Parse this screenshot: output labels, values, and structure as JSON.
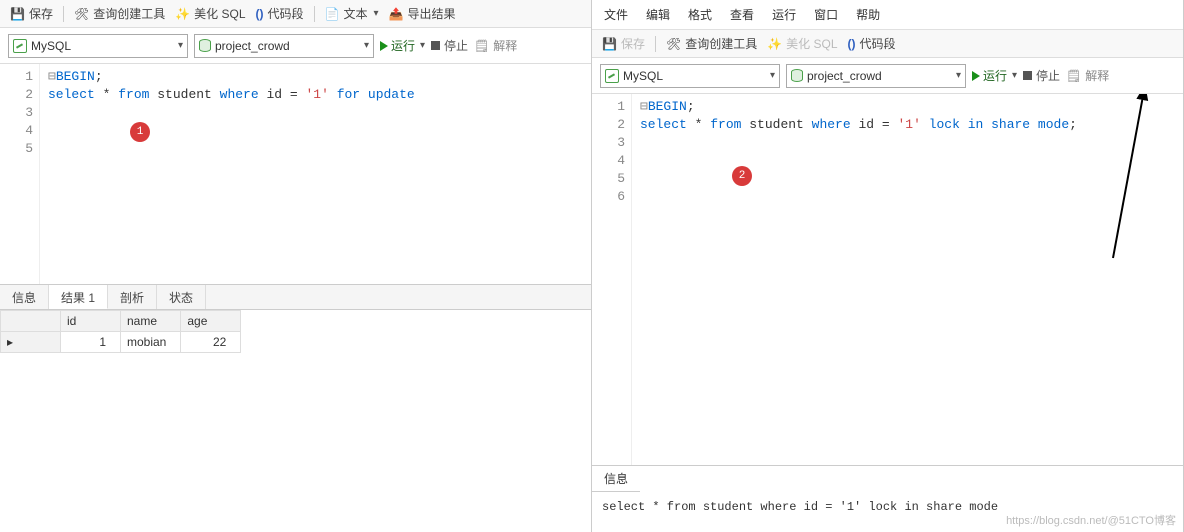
{
  "left": {
    "toolbarA": {
      "save": "保存",
      "queryBuilder": "查询创建工具",
      "beautify": "美化 SQL",
      "snippet": "代码段",
      "text": "文本",
      "export": "导出结果"
    },
    "toolbarB": {
      "connection": "MySQL",
      "database": "project_crowd",
      "run": "运行",
      "stop": "停止",
      "explain": "解释"
    },
    "code": {
      "lines": [
        "1",
        "2",
        "3",
        "4",
        "5"
      ],
      "l1_begin": "BEGIN",
      "l1_semi": ";",
      "l2_select": "select",
      "l2_star": " * ",
      "l2_from": "from",
      "l2_student": " student ",
      "l2_where": "where",
      "l2_id_eq": " id = ",
      "l2_val": "'1'",
      "l2_for": " for ",
      "l2_update": "update"
    },
    "badge": "1",
    "tabs": {
      "info": "信息",
      "result1": "结果 1",
      "profile": "剖析",
      "status": "状态"
    },
    "table": {
      "headers": {
        "id": "id",
        "name": "name",
        "age": "age"
      },
      "rows": [
        {
          "id": "1",
          "name": "mobian",
          "age": "22"
        }
      ]
    }
  },
  "right": {
    "menu": {
      "file": "文件",
      "edit": "编辑",
      "format": "格式",
      "view": "查看",
      "run": "运行",
      "window": "窗口",
      "help": "帮助"
    },
    "toolbarA": {
      "save": "保存",
      "queryBuilder": "查询创建工具",
      "beautify": "美化 SQL",
      "snippet": "代码段"
    },
    "toolbarB": {
      "connection": "MySQL",
      "database": "project_crowd",
      "run": "运行",
      "stop": "停止",
      "explain": "解释"
    },
    "code": {
      "lines": [
        "1",
        "2",
        "3",
        "4",
        "5",
        "6"
      ],
      "l1_begin": "BEGIN",
      "l1_semi": ";",
      "l2_select": "select",
      "l2_star": " * ",
      "l2_from": "from",
      "l2_student": " student ",
      "l2_where": "where",
      "l2_id_eq": " id = ",
      "l2_val": "'1'",
      "l2_lock": " lock in share mode",
      "l2_semi": ";"
    },
    "badge": "2",
    "infoTab": "信息",
    "infoBody": "select * from student where id = '1' lock in share mode"
  },
  "watermark": "https://blog.csdn.net/@51CTO博客"
}
